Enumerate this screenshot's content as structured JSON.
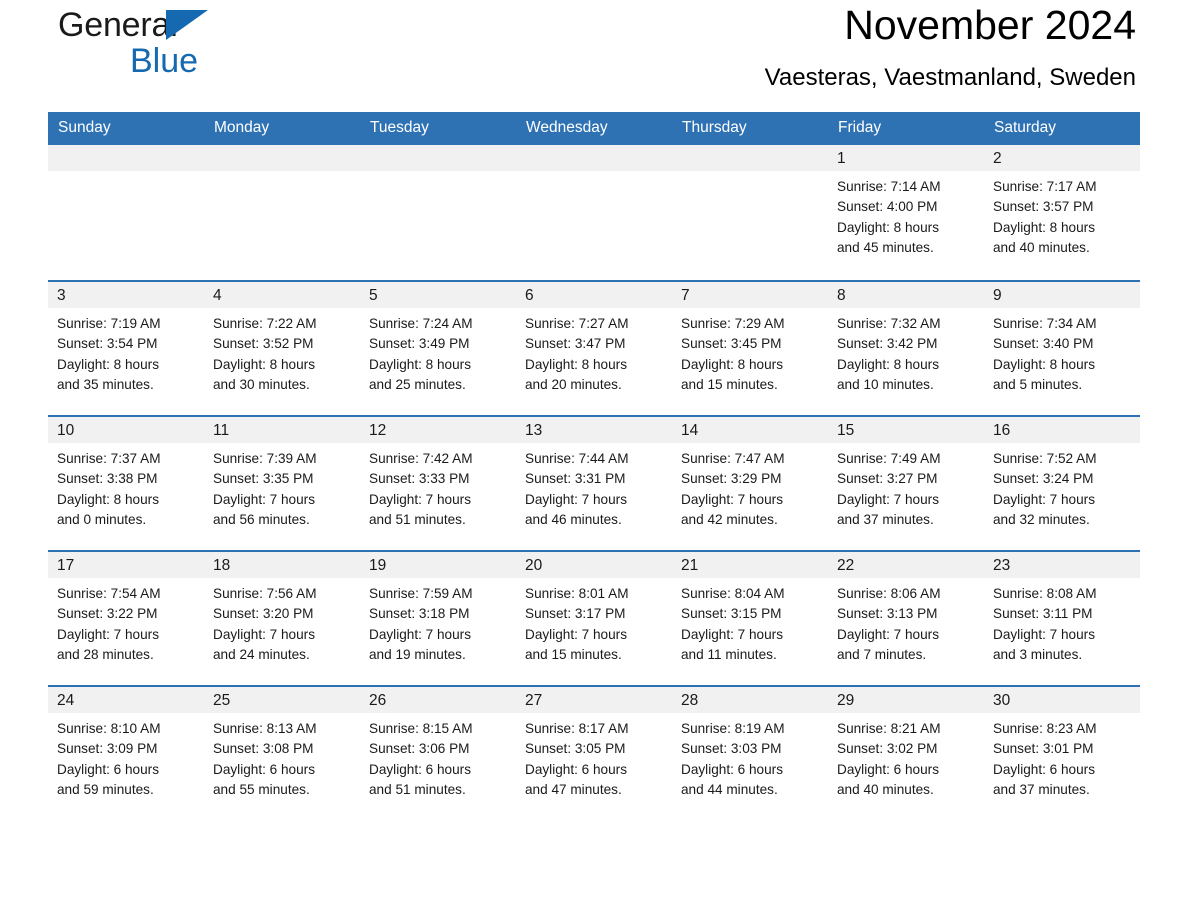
{
  "logo": {
    "word1": "General",
    "word2": "Blue",
    "triangle_color": "#1569b0",
    "word2_color": "#1569b0"
  },
  "header": {
    "month_title": "November 2024",
    "location": "Vaesteras, Vaestmanland, Sweden"
  },
  "theme": {
    "header_blue": "#2e72b4",
    "row_rule_blue": "#2e72b4",
    "daynum_band": "#f1f1f1",
    "text": "#1a1a1a"
  },
  "calendar": {
    "weekday_headers": [
      "Sunday",
      "Monday",
      "Tuesday",
      "Wednesday",
      "Thursday",
      "Friday",
      "Saturday"
    ],
    "weeks": [
      [
        {
          "day": "",
          "empty": true
        },
        {
          "day": "",
          "empty": true
        },
        {
          "day": "",
          "empty": true
        },
        {
          "day": "",
          "empty": true
        },
        {
          "day": "",
          "empty": true
        },
        {
          "day": "1",
          "sunrise": "Sunrise: 7:14 AM",
          "sunset": "Sunset: 4:00 PM",
          "daylight": "Daylight: 8 hours and 45 minutes."
        },
        {
          "day": "2",
          "sunrise": "Sunrise: 7:17 AM",
          "sunset": "Sunset: 3:57 PM",
          "daylight": "Daylight: 8 hours and 40 minutes."
        }
      ],
      [
        {
          "day": "3",
          "sunrise": "Sunrise: 7:19 AM",
          "sunset": "Sunset: 3:54 PM",
          "daylight": "Daylight: 8 hours and 35 minutes."
        },
        {
          "day": "4",
          "sunrise": "Sunrise: 7:22 AM",
          "sunset": "Sunset: 3:52 PM",
          "daylight": "Daylight: 8 hours and 30 minutes."
        },
        {
          "day": "5",
          "sunrise": "Sunrise: 7:24 AM",
          "sunset": "Sunset: 3:49 PM",
          "daylight": "Daylight: 8 hours and 25 minutes."
        },
        {
          "day": "6",
          "sunrise": "Sunrise: 7:27 AM",
          "sunset": "Sunset: 3:47 PM",
          "daylight": "Daylight: 8 hours and 20 minutes."
        },
        {
          "day": "7",
          "sunrise": "Sunrise: 7:29 AM",
          "sunset": "Sunset: 3:45 PM",
          "daylight": "Daylight: 8 hours and 15 minutes."
        },
        {
          "day": "8",
          "sunrise": "Sunrise: 7:32 AM",
          "sunset": "Sunset: 3:42 PM",
          "daylight": "Daylight: 8 hours and 10 minutes."
        },
        {
          "day": "9",
          "sunrise": "Sunrise: 7:34 AM",
          "sunset": "Sunset: 3:40 PM",
          "daylight": "Daylight: 8 hours and 5 minutes."
        }
      ],
      [
        {
          "day": "10",
          "sunrise": "Sunrise: 7:37 AM",
          "sunset": "Sunset: 3:38 PM",
          "daylight": "Daylight: 8 hours and 0 minutes."
        },
        {
          "day": "11",
          "sunrise": "Sunrise: 7:39 AM",
          "sunset": "Sunset: 3:35 PM",
          "daylight": "Daylight: 7 hours and 56 minutes."
        },
        {
          "day": "12",
          "sunrise": "Sunrise: 7:42 AM",
          "sunset": "Sunset: 3:33 PM",
          "daylight": "Daylight: 7 hours and 51 minutes."
        },
        {
          "day": "13",
          "sunrise": "Sunrise: 7:44 AM",
          "sunset": "Sunset: 3:31 PM",
          "daylight": "Daylight: 7 hours and 46 minutes."
        },
        {
          "day": "14",
          "sunrise": "Sunrise: 7:47 AM",
          "sunset": "Sunset: 3:29 PM",
          "daylight": "Daylight: 7 hours and 42 minutes."
        },
        {
          "day": "15",
          "sunrise": "Sunrise: 7:49 AM",
          "sunset": "Sunset: 3:27 PM",
          "daylight": "Daylight: 7 hours and 37 minutes."
        },
        {
          "day": "16",
          "sunrise": "Sunrise: 7:52 AM",
          "sunset": "Sunset: 3:24 PM",
          "daylight": "Daylight: 7 hours and 32 minutes."
        }
      ],
      [
        {
          "day": "17",
          "sunrise": "Sunrise: 7:54 AM",
          "sunset": "Sunset: 3:22 PM",
          "daylight": "Daylight: 7 hours and 28 minutes."
        },
        {
          "day": "18",
          "sunrise": "Sunrise: 7:56 AM",
          "sunset": "Sunset: 3:20 PM",
          "daylight": "Daylight: 7 hours and 24 minutes."
        },
        {
          "day": "19",
          "sunrise": "Sunrise: 7:59 AM",
          "sunset": "Sunset: 3:18 PM",
          "daylight": "Daylight: 7 hours and 19 minutes."
        },
        {
          "day": "20",
          "sunrise": "Sunrise: 8:01 AM",
          "sunset": "Sunset: 3:17 PM",
          "daylight": "Daylight: 7 hours and 15 minutes."
        },
        {
          "day": "21",
          "sunrise": "Sunrise: 8:04 AM",
          "sunset": "Sunset: 3:15 PM",
          "daylight": "Daylight: 7 hours and 11 minutes."
        },
        {
          "day": "22",
          "sunrise": "Sunrise: 8:06 AM",
          "sunset": "Sunset: 3:13 PM",
          "daylight": "Daylight: 7 hours and 7 minutes."
        },
        {
          "day": "23",
          "sunrise": "Sunrise: 8:08 AM",
          "sunset": "Sunset: 3:11 PM",
          "daylight": "Daylight: 7 hours and 3 minutes."
        }
      ],
      [
        {
          "day": "24",
          "sunrise": "Sunrise: 8:10 AM",
          "sunset": "Sunset: 3:09 PM",
          "daylight": "Daylight: 6 hours and 59 minutes."
        },
        {
          "day": "25",
          "sunrise": "Sunrise: 8:13 AM",
          "sunset": "Sunset: 3:08 PM",
          "daylight": "Daylight: 6 hours and 55 minutes."
        },
        {
          "day": "26",
          "sunrise": "Sunrise: 8:15 AM",
          "sunset": "Sunset: 3:06 PM",
          "daylight": "Daylight: 6 hours and 51 minutes."
        },
        {
          "day": "27",
          "sunrise": "Sunrise: 8:17 AM",
          "sunset": "Sunset: 3:05 PM",
          "daylight": "Daylight: 6 hours and 47 minutes."
        },
        {
          "day": "28",
          "sunrise": "Sunrise: 8:19 AM",
          "sunset": "Sunset: 3:03 PM",
          "daylight": "Daylight: 6 hours and 44 minutes."
        },
        {
          "day": "29",
          "sunrise": "Sunrise: 8:21 AM",
          "sunset": "Sunset: 3:02 PM",
          "daylight": "Daylight: 6 hours and 40 minutes."
        },
        {
          "day": "30",
          "sunrise": "Sunrise: 8:23 AM",
          "sunset": "Sunset: 3:01 PM",
          "daylight": "Daylight: 6 hours and 37 minutes."
        }
      ]
    ]
  }
}
